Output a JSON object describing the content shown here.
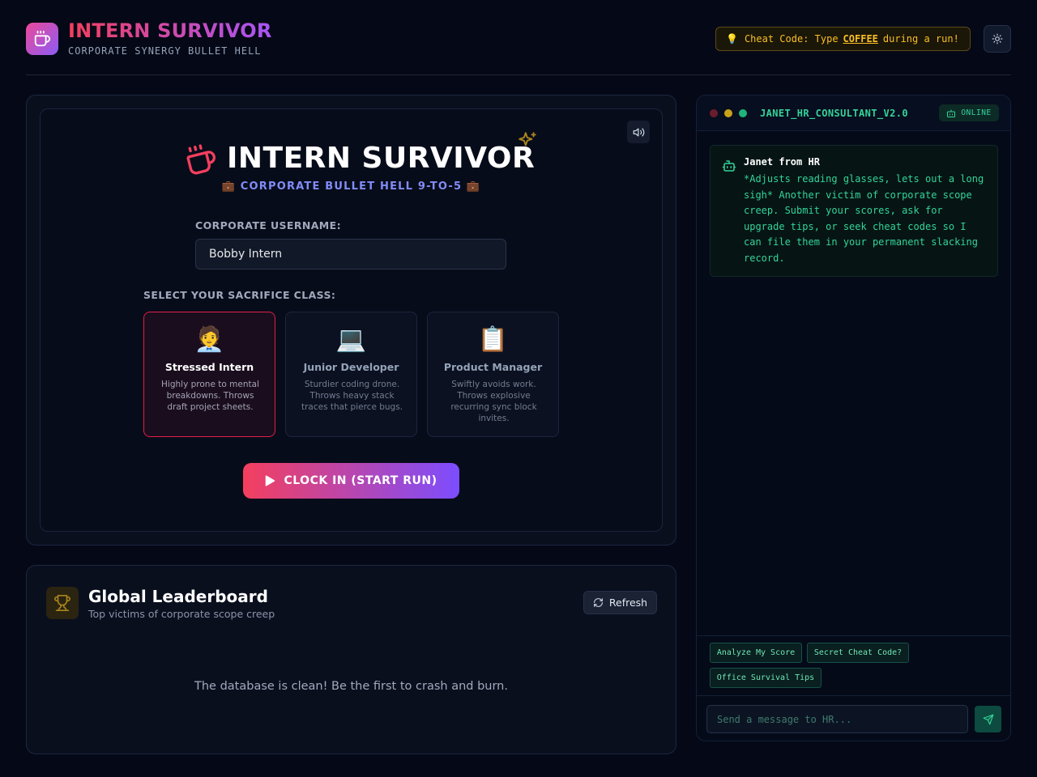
{
  "header": {
    "title": "INTERN SURVIVOR",
    "subtitle": "CORPORATE SYNERGY BULLET HELL",
    "cheat_prefix": "Cheat Code: Type",
    "cheat_code": "COFFEE",
    "cheat_suffix": "during a run!",
    "logo_icon": "coffee-icon",
    "theme_icon": "sun-icon"
  },
  "game": {
    "title": "INTERN SURVIVOR",
    "subtitle": "💼 CORPORATE BULLET HELL 9-TO-5 💼",
    "username_label": "CORPORATE USERNAME:",
    "username_value": "Bobby Intern",
    "class_label": "SELECT YOUR SACRIFICE CLASS:",
    "classes": [
      {
        "emoji": "🧑‍💼",
        "name": "Stressed Intern",
        "desc": "Highly prone to mental breakdowns. Throws draft project sheets.",
        "selected": true
      },
      {
        "emoji": "💻",
        "name": "Junior Developer",
        "desc": "Sturdier coding drone. Throws heavy stack traces that pierce bugs.",
        "selected": false
      },
      {
        "emoji": "📋",
        "name": "Product Manager",
        "desc": "Swiftly avoids work. Throws explosive recurring sync block invites.",
        "selected": false
      }
    ],
    "start_label": "CLOCK IN (START RUN)"
  },
  "leaderboard": {
    "title": "Global Leaderboard",
    "subtitle": "Top victims of corporate scope creep",
    "refresh_label": "Refresh",
    "empty_text": "The database is clean! Be the first to crash and burn."
  },
  "chat": {
    "name": "JANET_HR_CONSULTANT_V2.0",
    "status": "ONLINE",
    "message_author": "Janet from HR",
    "message_text": "*Adjusts reading glasses, lets out a long sigh* Another victim of corporate scope creep. Submit your scores, ask for upgrade tips, or seek cheat codes so I can file them in your permanent slacking record.",
    "chips": [
      "Analyze My Score",
      "Secret Cheat Code?",
      "Office Survival Tips"
    ],
    "input_placeholder": "Send a message to HR..."
  },
  "colors": {
    "background": "#050816",
    "accent_pink": "#f43f5e",
    "accent_purple": "#7c4dff",
    "terminal_green": "#34d399",
    "cheat_yellow": "#fbbf24"
  }
}
